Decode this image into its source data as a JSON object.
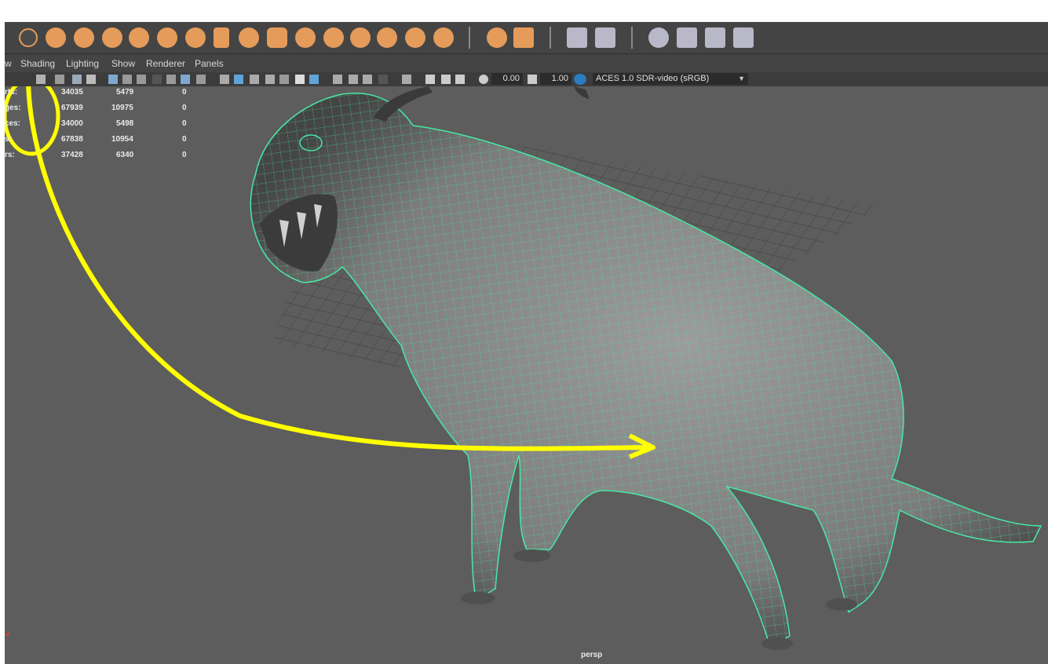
{
  "menus": [
    "w",
    "Shading",
    "Lighting",
    "Show",
    "Renderer",
    "Panels"
  ],
  "toolbar": {
    "exposure_value": "0.00",
    "gamma_value": "1.00",
    "view_transform": "ACES 1.0 SDR-video (sRGB)"
  },
  "hud": {
    "rows": [
      {
        "label": "rts:",
        "a": "34035",
        "b": "5479",
        "c": "0"
      },
      {
        "label": "ges:",
        "a": "67939",
        "b": "10975",
        "c": "0"
      },
      {
        "label": "ces:",
        "a": "34000",
        "b": "5498",
        "c": "0"
      },
      {
        "label": "s:",
        "a": "67838",
        "b": "10954",
        "c": "0"
      },
      {
        "label": "rs:",
        "a": "37428",
        "b": "6340",
        "c": "0"
      }
    ]
  },
  "camera_label": "persp",
  "colors": {
    "shelf_icon": "#e59b5a",
    "wireframe": "#48e8a6",
    "annotation": "#ffff00",
    "viewport_bg": "#5d5d5d"
  }
}
